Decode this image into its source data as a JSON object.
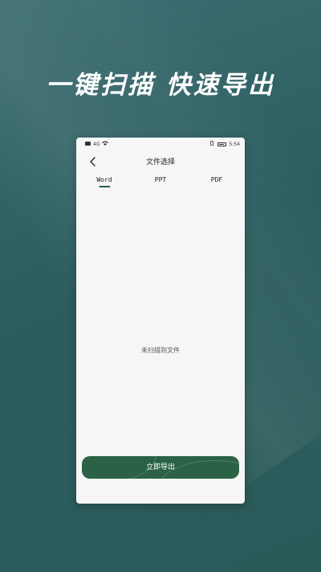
{
  "headline": "一键扫描 快速导出",
  "status_bar": {
    "left_signal": "4G",
    "time": "5:54"
  },
  "nav": {
    "title": "文件选择"
  },
  "tabs": [
    {
      "label": "Word",
      "active": true
    },
    {
      "label": "PPT",
      "active": false
    },
    {
      "label": "PDF",
      "active": false
    }
  ],
  "empty_state": "未扫描到文件",
  "export_button": "立即导出",
  "colors": {
    "background": "#2c5d5f",
    "accent": "#2b6245",
    "card": "#f6f6f6"
  }
}
